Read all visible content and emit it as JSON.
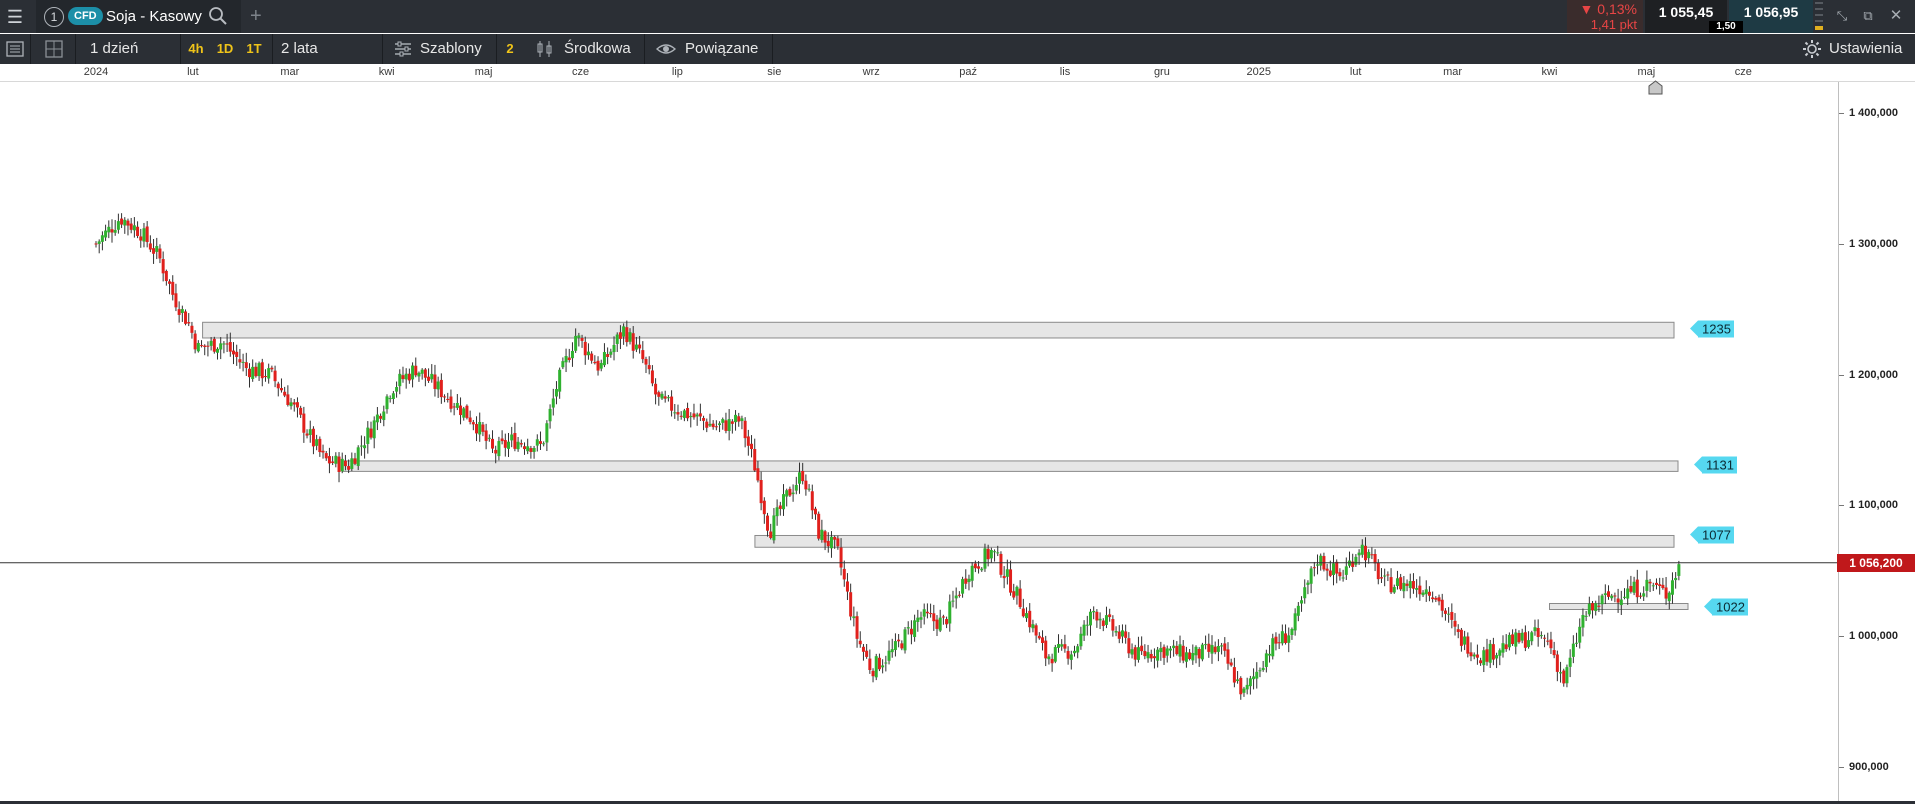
{
  "header": {
    "instrument_number": "1",
    "cfd_badge": "CFD",
    "title": "Soja - Kasowy",
    "add_tab": "+"
  },
  "quote": {
    "change_pct": "▼ 0,13%",
    "change_pts": "1,41 pkt",
    "bid": "1 055,45",
    "spread": "1,50",
    "ask": "1 056,95"
  },
  "toolbar": {
    "interval": "1 dzień",
    "tf_4h": "4h",
    "tf_1d": "1D",
    "tf_1t": "1T",
    "range": "2 lata",
    "templates": "Szablony",
    "templates_count": "2",
    "price_mode": "Środkowa",
    "related": "Powiązane",
    "settings": "Ustawienia"
  },
  "time_axis": {
    "months": [
      {
        "label": "2024",
        "x": 0
      },
      {
        "label": "lut",
        "x": 1
      },
      {
        "label": "mar",
        "x": 2
      },
      {
        "label": "kwi",
        "x": 3
      },
      {
        "label": "maj",
        "x": 4
      },
      {
        "label": "cze",
        "x": 5
      },
      {
        "label": "lip",
        "x": 6
      },
      {
        "label": "sie",
        "x": 7
      },
      {
        "label": "wrz",
        "x": 8
      },
      {
        "label": "paź",
        "x": 9
      },
      {
        "label": "lis",
        "x": 10
      },
      {
        "label": "gru",
        "x": 11
      },
      {
        "label": "2025",
        "x": 12
      },
      {
        "label": "lut",
        "x": 13
      },
      {
        "label": "mar",
        "x": 14
      },
      {
        "label": "kwi",
        "x": 15
      },
      {
        "label": "maj",
        "x": 16
      },
      {
        "label": "cze",
        "x": 17
      }
    ]
  },
  "price_axis": {
    "labels": [
      {
        "label": "1 400,000",
        "value": 1400
      },
      {
        "label": "1 300,000",
        "value": 1300
      },
      {
        "label": "1 200,000",
        "value": 1200
      },
      {
        "label": "1 100,000",
        "value": 1100
      },
      {
        "label": "1 000,000",
        "value": 1000
      },
      {
        "label": "900,000",
        "value": 900
      }
    ],
    "current_label": "1 056,200",
    "current_value": 1056.2
  },
  "levels": [
    {
      "label": "1235",
      "value": 1235,
      "zone": [
        1228,
        1240
      ],
      "start_month": 1.1
    },
    {
      "label": "1131",
      "value": 1131,
      "zone": [
        1126,
        1134
      ],
      "start_month": 2.55
    },
    {
      "label": "1077",
      "value": 1077,
      "zone": [
        1068,
        1077
      ],
      "start_month": 6.8
    },
    {
      "label": "1022",
      "value": 1022,
      "zone": [
        1021,
        1025
      ],
      "start_month": 15.0
    }
  ],
  "chart_data": {
    "type": "candlestick",
    "start_date": "2024-01-01",
    "x_unit": "month index (0 = Jan 2024)",
    "path_points": [
      [
        0.0,
        1300
      ],
      [
        0.25,
        1320
      ],
      [
        0.45,
        1310
      ],
      [
        0.65,
        1290
      ],
      [
        0.8,
        1260
      ],
      [
        0.95,
        1240
      ],
      [
        1.05,
        1220
      ],
      [
        1.3,
        1225
      ],
      [
        1.55,
        1205
      ],
      [
        1.8,
        1200
      ],
      [
        2.0,
        1180
      ],
      [
        2.15,
        1160
      ],
      [
        2.35,
        1135
      ],
      [
        2.6,
        1130
      ],
      [
        2.85,
        1160
      ],
      [
        3.05,
        1190
      ],
      [
        3.3,
        1205
      ],
      [
        3.6,
        1185
      ],
      [
        3.9,
        1165
      ],
      [
        4.1,
        1140
      ],
      [
        4.3,
        1150
      ],
      [
        4.6,
        1145
      ],
      [
        4.75,
        1190
      ],
      [
        4.95,
        1230
      ],
      [
        5.2,
        1205
      ],
      [
        5.45,
        1235
      ],
      [
        5.65,
        1210
      ],
      [
        5.8,
        1180
      ],
      [
        6.1,
        1170
      ],
      [
        6.4,
        1160
      ],
      [
        6.65,
        1165
      ],
      [
        6.8,
        1130
      ],
      [
        6.95,
        1080
      ],
      [
        7.15,
        1110
      ],
      [
        7.3,
        1125
      ],
      [
        7.45,
        1080
      ],
      [
        7.65,
        1065
      ],
      [
        7.85,
        1000
      ],
      [
        8.0,
        975
      ],
      [
        8.25,
        990
      ],
      [
        8.5,
        1015
      ],
      [
        8.75,
        1010
      ],
      [
        9.0,
        1050
      ],
      [
        9.25,
        1065
      ],
      [
        9.55,
        1025
      ],
      [
        9.8,
        985
      ],
      [
        10.1,
        990
      ],
      [
        10.3,
        1020
      ],
      [
        10.5,
        1005
      ],
      [
        10.75,
        985
      ],
      [
        11.0,
        990
      ],
      [
        11.3,
        985
      ],
      [
        11.6,
        990
      ],
      [
        11.85,
        955
      ],
      [
        12.1,
        990
      ],
      [
        12.35,
        1005
      ],
      [
        12.6,
        1060
      ],
      [
        12.85,
        1045
      ],
      [
        13.05,
        1070
      ],
      [
        13.3,
        1040
      ],
      [
        13.55,
        1040
      ],
      [
        13.8,
        1035
      ],
      [
        14.05,
        1000
      ],
      [
        14.3,
        985
      ],
      [
        14.6,
        995
      ],
      [
        14.85,
        1000
      ],
      [
        15.0,
        995
      ],
      [
        15.15,
        965
      ],
      [
        15.35,
        1015
      ],
      [
        15.6,
        1030
      ],
      [
        15.85,
        1035
      ],
      [
        16.05,
        1040
      ],
      [
        16.2,
        1032
      ],
      [
        16.35,
        1056
      ]
    ],
    "ylim": [
      880,
      1450
    ]
  }
}
